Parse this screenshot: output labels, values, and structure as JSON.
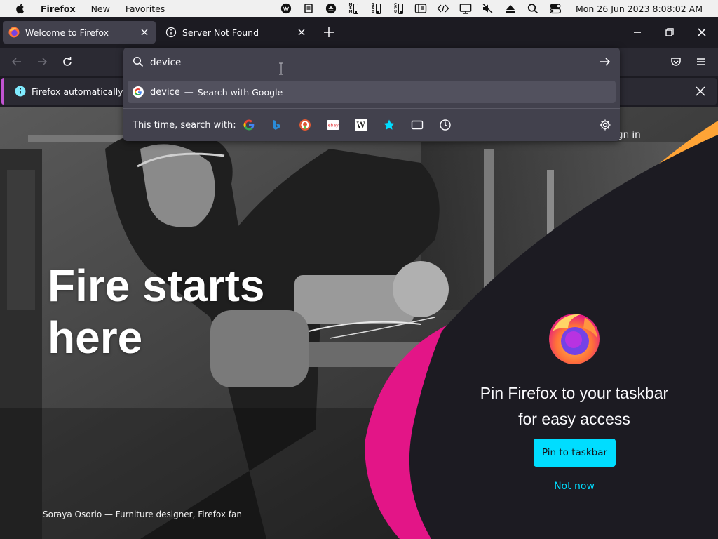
{
  "menubar": {
    "app_name": "Firefox",
    "menus": [
      "New",
      "Favorites"
    ],
    "meters": [
      "MEM",
      "SSD",
      "CPU"
    ],
    "clock": "Mon 26 Jun 2023  8:08:02 AM"
  },
  "tabs": [
    {
      "title": "Welcome to Firefox",
      "icon": "firefox-icon",
      "active": true
    },
    {
      "title": "Server Not Found",
      "icon": "info-icon",
      "active": false
    }
  ],
  "urlbar": {
    "value": "device",
    "suggestion": {
      "term": "device",
      "separator": "—",
      "action": "Search with Google"
    },
    "oneoff_label": "This time, search with:",
    "engines": [
      "google-icon",
      "bing-icon",
      "duckduckgo-icon",
      "ebay-icon",
      "wikipedia-icon",
      "bookmarks-icon",
      "tabs-icon",
      "history-icon"
    ],
    "ebay_text": "ebay",
    "wikipedia_text": "W"
  },
  "notification": {
    "text": "Firefox automatically sen"
  },
  "hero": {
    "headline_line1": "Fire starts",
    "headline_line2": "here",
    "caption": "Soraya Osorio — Furniture designer, Firefox fan",
    "signin_partial": "gn in",
    "pin_title_line1": "Pin Firefox to your taskbar",
    "pin_title_line2": "for easy access",
    "pin_button": "Pin to taskbar",
    "not_now": "Not now"
  },
  "colors": {
    "accent_cyan": "#00ddff",
    "magenta": "#e31587",
    "orange": "#ffa436",
    "panel_bg": "#42414d",
    "toolbar_bg": "#2b2a33",
    "frame_bg": "#1c1b22"
  }
}
